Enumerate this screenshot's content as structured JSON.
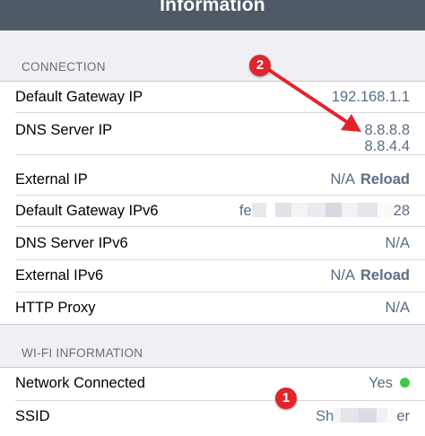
{
  "navbar": {
    "title": "Information"
  },
  "sections": {
    "connection": "CONNECTION",
    "wifi": "WI-FI INFORMATION"
  },
  "rows": {
    "default_gateway_ip": {
      "label": "Default Gateway IP",
      "value": "192.168.1.1"
    },
    "dns_server_ip": {
      "label": "DNS Server IP",
      "value1": "8.8.8.8",
      "value2": "8.8.4.4"
    },
    "external_ip": {
      "label": "External IP",
      "value": "N/A",
      "action": "Reload"
    },
    "default_gateway_ipv6": {
      "label": "Default Gateway IPv6",
      "value_start": "fe",
      "value_end": "28"
    },
    "dns_server_ipv6": {
      "label": "DNS Server IPv6",
      "value": "N/A"
    },
    "external_ipv6": {
      "label": "External IPv6",
      "value": "N/A",
      "action": "Reload"
    },
    "http_proxy": {
      "label": "HTTP Proxy",
      "value": "N/A"
    },
    "network_connected": {
      "label": "Network Connected",
      "value": "Yes"
    },
    "ssid": {
      "label": "SSID",
      "value_start": "Sh",
      "value_end": "er"
    }
  },
  "annotations": {
    "badge1": "1",
    "badge2": "2"
  },
  "colors": {
    "navbar": "#4f5a66",
    "value_text": "#5a6d86",
    "status_dot": "#3ec94a",
    "annotation_red": "#e0262b"
  }
}
